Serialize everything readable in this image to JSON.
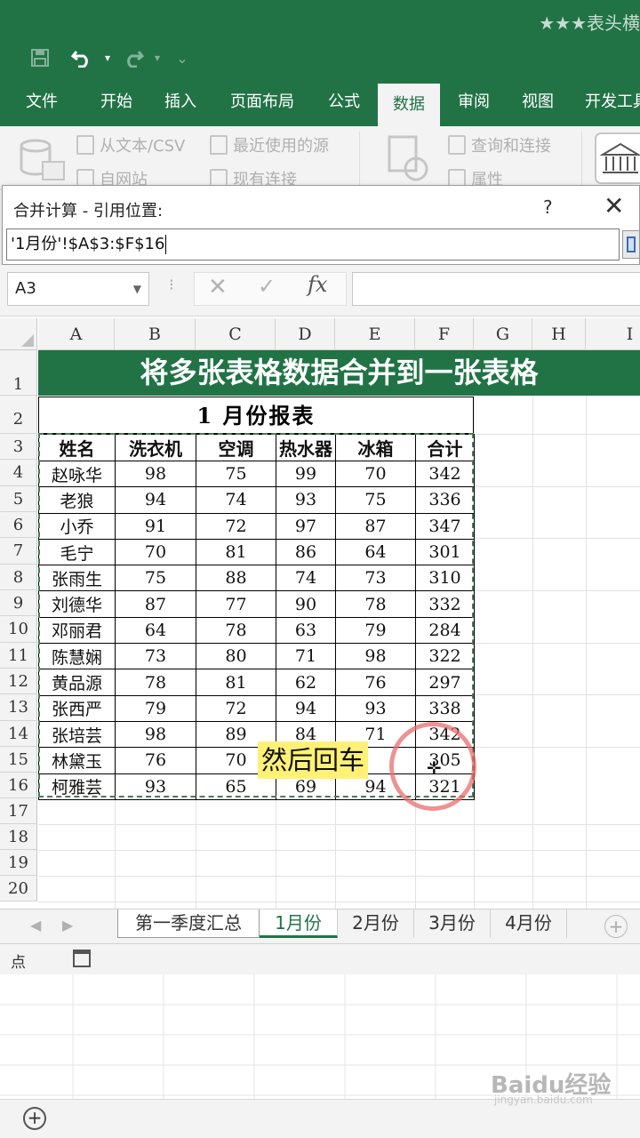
{
  "window": {
    "doc_title": "★★★表头横"
  },
  "ribbon_tabs": [
    {
      "label": "文件",
      "active": false
    },
    {
      "label": "开始",
      "active": false
    },
    {
      "label": "插入",
      "active": false
    },
    {
      "label": "页面布局",
      "active": false
    },
    {
      "label": "公式",
      "active": false
    },
    {
      "label": "数据",
      "active": true
    },
    {
      "label": "审阅",
      "active": false
    },
    {
      "label": "视图",
      "active": false
    },
    {
      "label": "开发工具",
      "active": false
    }
  ],
  "ribbon_items": {
    "from_text_csv": "从文本/CSV",
    "from_web": "自网站",
    "recent_sources": "最近使用的源",
    "existing_connections": "现有连接",
    "queries_connections": "查询和连接",
    "properties": "属性"
  },
  "dialog": {
    "title": "合并计算 - 引用位置:",
    "help": "?",
    "close": "✕",
    "reference": "'1月份'!$A$3:$F$16"
  },
  "formula_bar": {
    "name_box": "A3",
    "fx_label": "fx",
    "content": ""
  },
  "column_headers": [
    "A",
    "B",
    "C",
    "D",
    "E",
    "F",
    "G",
    "H",
    "I"
  ],
  "row_headers": [
    "1",
    "2",
    "3",
    "4",
    "5",
    "6",
    "7",
    "8",
    "9",
    "10",
    "11",
    "12",
    "13",
    "14",
    "15",
    "16",
    "17",
    "18",
    "19",
    "20"
  ],
  "sheet": {
    "banner": "将多张表格数据合并到一张表格",
    "report_title": "1 月份报表",
    "table_headers": [
      "姓名",
      "洗衣机",
      "空调",
      "热水器",
      "冰箱",
      "合计"
    ],
    "rows": [
      [
        "赵咏华",
        "98",
        "75",
        "99",
        "70",
        "342"
      ],
      [
        "老狼",
        "94",
        "74",
        "93",
        "75",
        "336"
      ],
      [
        "小乔",
        "91",
        "72",
        "97",
        "87",
        "347"
      ],
      [
        "毛宁",
        "70",
        "81",
        "86",
        "64",
        "301"
      ],
      [
        "张雨生",
        "75",
        "88",
        "74",
        "73",
        "310"
      ],
      [
        "刘德华",
        "87",
        "77",
        "90",
        "78",
        "332"
      ],
      [
        "邓丽君",
        "64",
        "78",
        "63",
        "79",
        "284"
      ],
      [
        "陈慧娴",
        "73",
        "80",
        "71",
        "98",
        "322"
      ],
      [
        "黄品源",
        "78",
        "81",
        "62",
        "76",
        "297"
      ],
      [
        "张西严",
        "79",
        "72",
        "94",
        "93",
        "338"
      ],
      [
        "张培芸",
        "98",
        "89",
        "84",
        "71",
        "342"
      ],
      [
        "林黛玉",
        "76",
        "70",
        "",
        "",
        "305"
      ],
      [
        "柯雅芸",
        "93",
        "65",
        "69",
        "94",
        "321"
      ]
    ]
  },
  "annotation": {
    "callout": "然后回车"
  },
  "sheet_tabs": [
    {
      "label": "第一季度汇总",
      "active": false
    },
    {
      "label": "1月份",
      "active": true
    },
    {
      "label": "2月份",
      "active": false
    },
    {
      "label": "3月份",
      "active": false
    },
    {
      "label": "4月份",
      "active": false
    }
  ],
  "status": {
    "mode": "点"
  },
  "watermark": {
    "main": "Baidu经验",
    "sub": "jingyan.baidu.com"
  }
}
